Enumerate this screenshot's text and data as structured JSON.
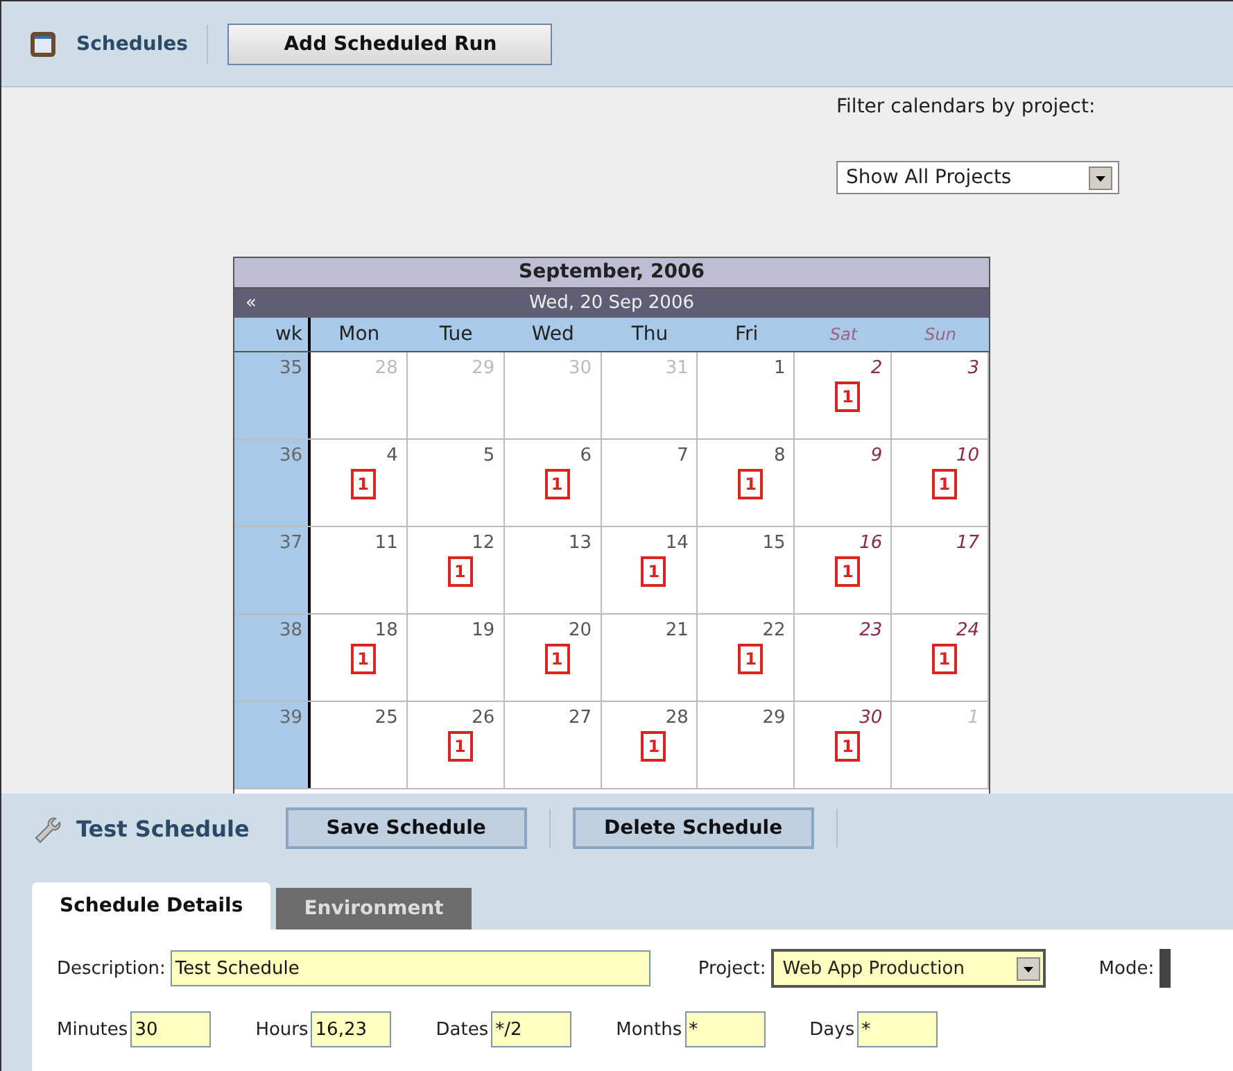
{
  "toolbar": {
    "title": "Schedules",
    "button": "Add Scheduled Run"
  },
  "filter": {
    "label": "Filter calendars by project:",
    "value": "Show All Projects"
  },
  "calendar": {
    "title": "September, 2006",
    "nav": "«",
    "current_date": "Wed, 20 Sep 2006",
    "week_header": "wk",
    "days": [
      {
        "label": "Mon",
        "kind": "weekday"
      },
      {
        "label": "Tue",
        "kind": "weekday"
      },
      {
        "label": "Wed",
        "kind": "weekday"
      },
      {
        "label": "Thu",
        "kind": "weekday"
      },
      {
        "label": "Fri",
        "kind": "weekday"
      },
      {
        "label": "Sat",
        "kind": "weekend"
      },
      {
        "label": "Sun",
        "kind": "weekend"
      }
    ],
    "weeks": [
      {
        "number": "35",
        "cells": [
          {
            "day": "28",
            "kind": "weekday",
            "other_month": true
          },
          {
            "day": "29",
            "kind": "weekday",
            "other_month": true
          },
          {
            "day": "30",
            "kind": "weekday",
            "other_month": true
          },
          {
            "day": "31",
            "kind": "weekday",
            "other_month": true
          },
          {
            "day": "1",
            "kind": "weekday",
            "other_month": false
          },
          {
            "day": "2",
            "kind": "weekend",
            "other_month": false,
            "events": "1"
          },
          {
            "day": "3",
            "kind": "weekend",
            "other_month": false
          }
        ]
      },
      {
        "number": "36",
        "cells": [
          {
            "day": "4",
            "kind": "weekday",
            "other_month": false,
            "events": "1"
          },
          {
            "day": "5",
            "kind": "weekday",
            "other_month": false
          },
          {
            "day": "6",
            "kind": "weekday",
            "other_month": false,
            "events": "1"
          },
          {
            "day": "7",
            "kind": "weekday",
            "other_month": false
          },
          {
            "day": "8",
            "kind": "weekday",
            "other_month": false,
            "events": "1"
          },
          {
            "day": "9",
            "kind": "weekend",
            "other_month": false
          },
          {
            "day": "10",
            "kind": "weekend",
            "other_month": false,
            "events": "1"
          }
        ]
      },
      {
        "number": "37",
        "cells": [
          {
            "day": "11",
            "kind": "weekday",
            "other_month": false
          },
          {
            "day": "12",
            "kind": "weekday",
            "other_month": false,
            "events": "1"
          },
          {
            "day": "13",
            "kind": "weekday",
            "other_month": false
          },
          {
            "day": "14",
            "kind": "weekday",
            "other_month": false,
            "events": "1"
          },
          {
            "day": "15",
            "kind": "weekday",
            "other_month": false
          },
          {
            "day": "16",
            "kind": "weekend",
            "other_month": false,
            "events": "1"
          },
          {
            "day": "17",
            "kind": "weekend",
            "other_month": false
          }
        ]
      },
      {
        "number": "38",
        "cells": [
          {
            "day": "18",
            "kind": "weekday",
            "other_month": false,
            "events": "1"
          },
          {
            "day": "19",
            "kind": "weekday",
            "other_month": false
          },
          {
            "day": "20",
            "kind": "weekday",
            "other_month": false,
            "events": "1"
          },
          {
            "day": "21",
            "kind": "weekday",
            "other_month": false
          },
          {
            "day": "22",
            "kind": "weekday",
            "other_month": false,
            "events": "1"
          },
          {
            "day": "23",
            "kind": "weekend",
            "other_month": false
          },
          {
            "day": "24",
            "kind": "weekend",
            "other_month": false,
            "events": "1"
          }
        ]
      },
      {
        "number": "39",
        "cells": [
          {
            "day": "25",
            "kind": "weekday",
            "other_month": false
          },
          {
            "day": "26",
            "kind": "weekday",
            "other_month": false,
            "events": "1"
          },
          {
            "day": "27",
            "kind": "weekday",
            "other_month": false
          },
          {
            "day": "28",
            "kind": "weekday",
            "other_month": false,
            "events": "1"
          },
          {
            "day": "29",
            "kind": "weekday",
            "other_month": false
          },
          {
            "day": "30",
            "kind": "weekend",
            "other_month": false,
            "events": "1"
          },
          {
            "day": "1",
            "kind": "weekend",
            "other_month": true
          }
        ]
      }
    ]
  },
  "schedule": {
    "title": "Test Schedule",
    "buttons": [
      "Save Schedule",
      "Delete Schedule"
    ],
    "tabs": [
      {
        "label": "Schedule Details",
        "selected": true
      },
      {
        "label": "Environment",
        "selected": false
      }
    ],
    "description": {
      "label": "Description:",
      "value": "Test Schedule"
    },
    "project": {
      "label": "Project:",
      "value": "Web App Production"
    },
    "mode": {
      "label": "Mode:"
    },
    "cron": [
      {
        "label": "Minutes",
        "value": "30"
      },
      {
        "label": "Hours",
        "value": "16,23"
      },
      {
        "label": "Dates",
        "value": "*/2"
      },
      {
        "label": "Months",
        "value": "*"
      },
      {
        "label": "Days",
        "value": "*"
      }
    ]
  }
}
